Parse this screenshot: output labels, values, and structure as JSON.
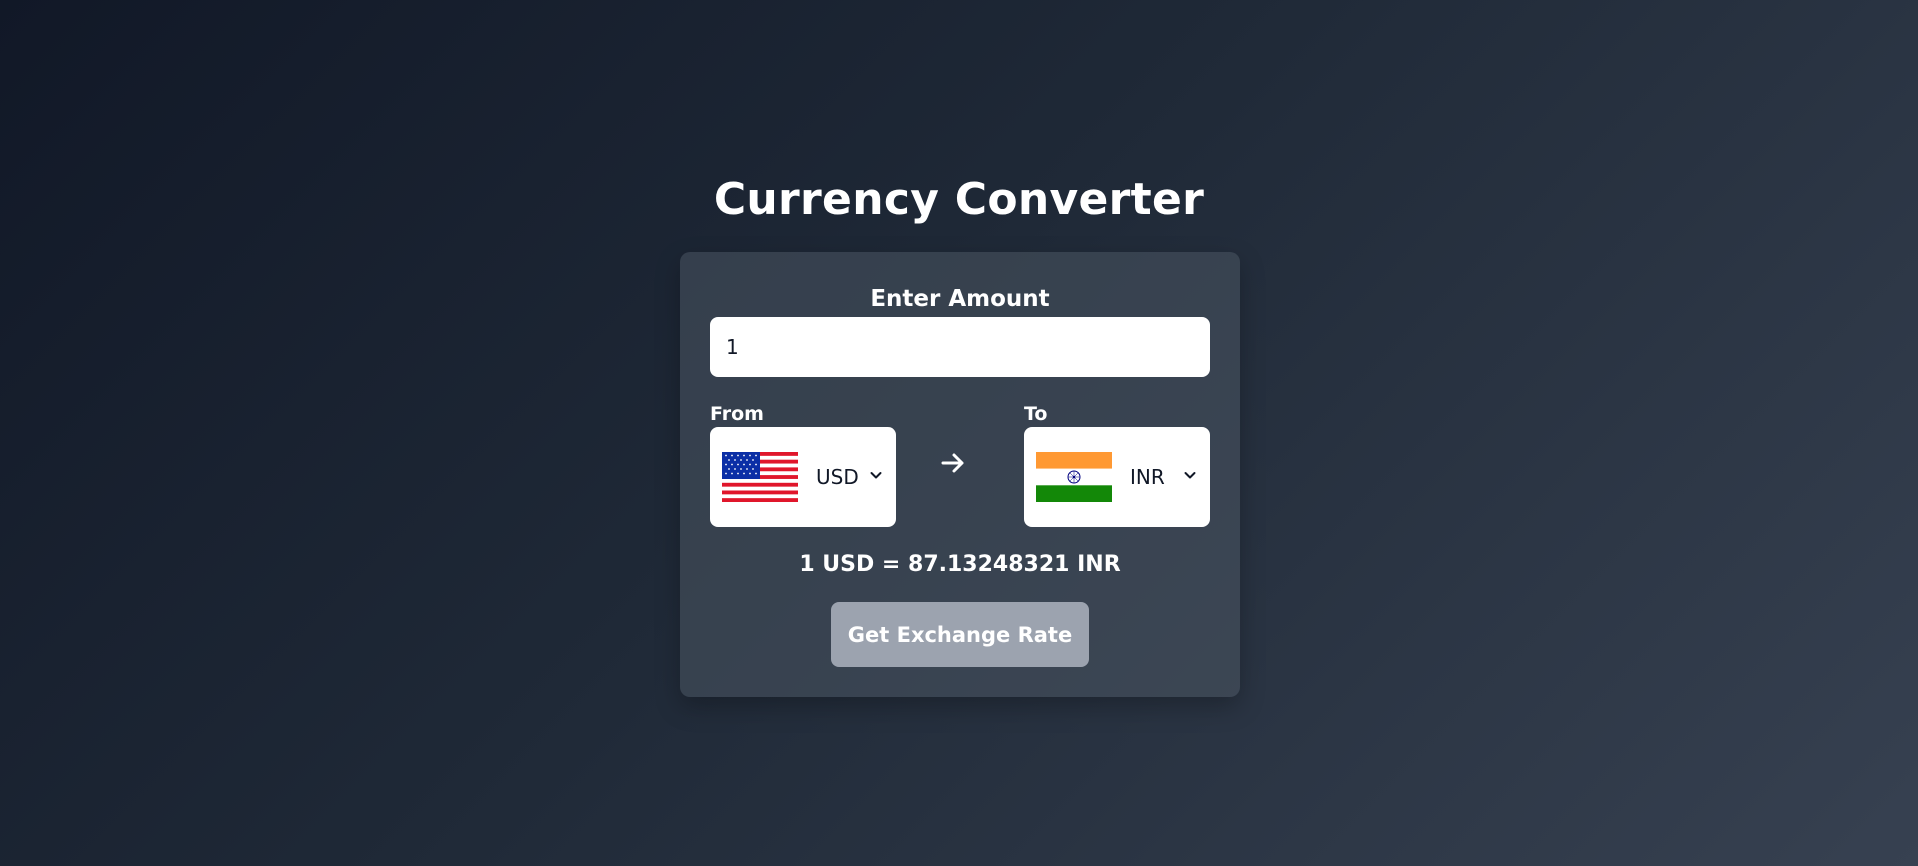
{
  "page": {
    "title": "Currency Converter"
  },
  "converter": {
    "amount_label": "Enter Amount",
    "amount_value": "1",
    "from_label": "From",
    "to_label": "To",
    "from_currency": {
      "code": "USD",
      "flag": "us-flag-icon"
    },
    "to_currency": {
      "code": "INR",
      "flag": "india-flag-icon"
    },
    "rate_text": "1 USD = 87.13248321 INR",
    "button_label": "Get Exchange Rate"
  },
  "colors": {
    "background_start": "#111827",
    "background_end": "#374151",
    "card": "#4b5563",
    "button": "#9ca3af",
    "text": "#ffffff"
  }
}
